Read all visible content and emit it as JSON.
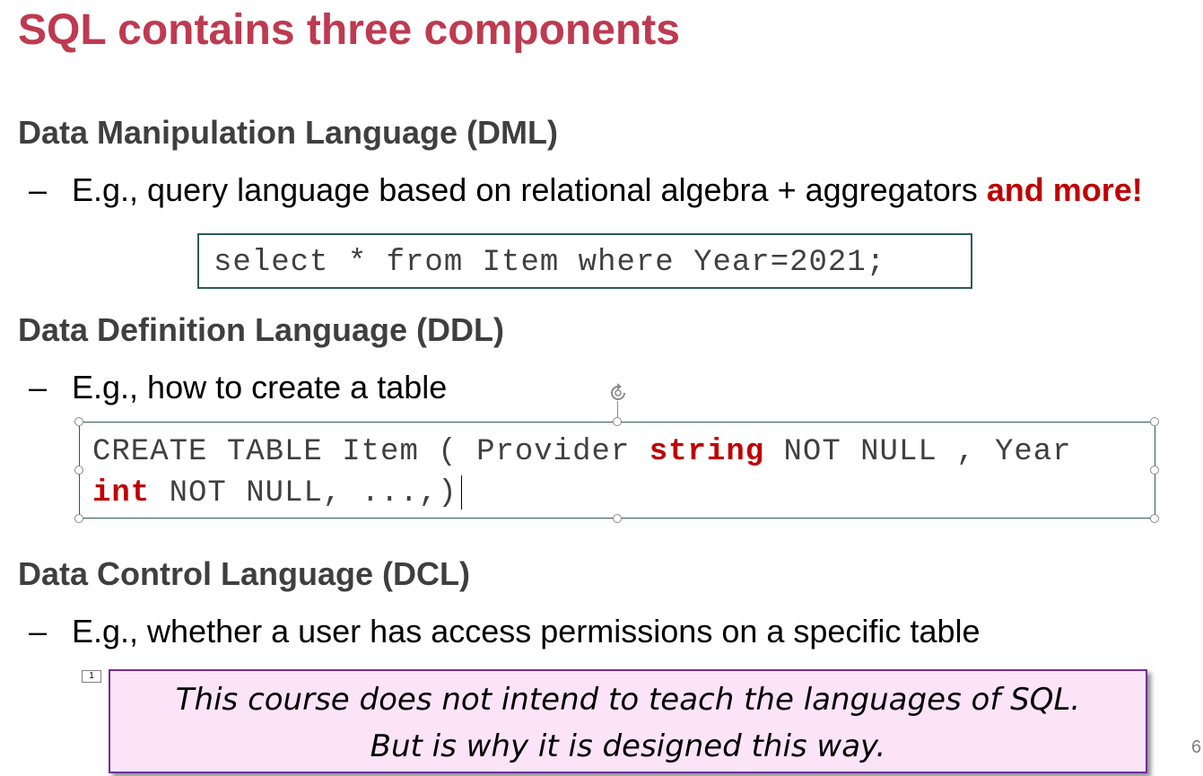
{
  "slide": {
    "title": "SQL contains three components",
    "page_number": "6"
  },
  "sections": {
    "dml": {
      "heading": "Data Manipulation Language (DML)",
      "bullet_dash": "–",
      "bullet_text": "E.g., query language based on relational algebra + aggregators ",
      "bullet_emphasis": "and more!",
      "code": "select * from Item where Year=2021;"
    },
    "ddl": {
      "heading": "Data Definition Language (DDL)",
      "bullet_dash": "–",
      "bullet_text": "E.g., how to create a table",
      "code": {
        "line1_part1": "CREATE TABLE Item ( Provider ",
        "line1_keyword": "string",
        "line1_part2": " NOT NULL , Year",
        "line2_keyword": "int",
        "line2_part": " NOT NULL, ...,)"
      }
    },
    "dcl": {
      "heading": "Data Control Language (DCL)",
      "bullet_dash": "–",
      "bullet_text": "E.g., whether a user has access permissions on a specific table"
    }
  },
  "note_marker": "1",
  "callout": {
    "line1": "This course does not intend to teach the languages of SQL.",
    "line2": "But is why it is designed this way."
  },
  "colors": {
    "title": "#be3a50",
    "heading": "#3f3f3f",
    "emphasis": "#c00000",
    "code_border": "#2e5a5a",
    "callout_background": "#fce4f8",
    "callout_border": "#7030a0"
  }
}
